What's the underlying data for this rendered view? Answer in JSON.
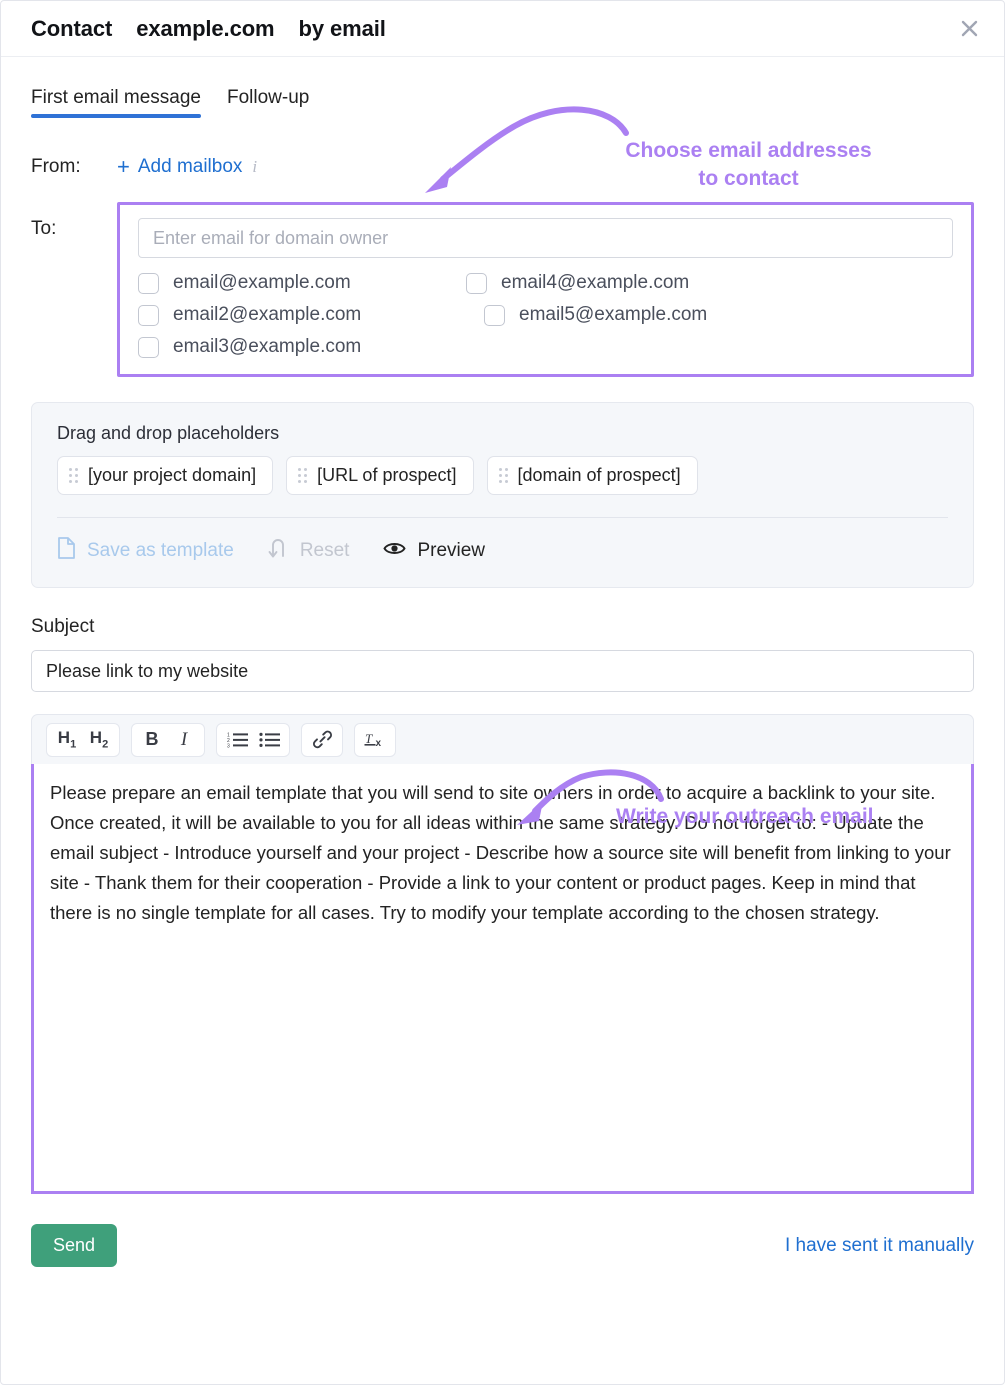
{
  "header": {
    "title_prefix": "Contact",
    "title_domain": "example.com",
    "title_suffix": "by email",
    "close_icon": "close-icon"
  },
  "tabs": [
    {
      "label": "First email message",
      "active": true
    },
    {
      "label": "Follow-up",
      "active": false
    }
  ],
  "from": {
    "label": "From:",
    "add_mailbox_label": "Add mailbox",
    "plus_glyph": "+",
    "info_glyph": "i"
  },
  "to": {
    "label": "To:",
    "input_placeholder": "Enter email for domain owner",
    "input_value": "",
    "emails": [
      {
        "address": "email@example.com",
        "checked": false
      },
      {
        "address": "email4@example.com",
        "checked": false
      },
      {
        "address": "email2@example.com",
        "checked": false
      },
      {
        "address": "email5@example.com",
        "checked": false
      },
      {
        "address": "email3@example.com",
        "checked": false
      }
    ]
  },
  "placeholders": {
    "title": "Drag and drop placeholders",
    "chips": [
      "[your project domain]",
      "[URL of prospect]",
      "[domain of prospect]"
    ],
    "actions": [
      {
        "label": "Save as template",
        "icon": "document-icon",
        "state": "muted-blue"
      },
      {
        "label": "Reset",
        "icon": "undo-arrow-icon",
        "state": "muted-grey"
      },
      {
        "label": "Preview",
        "icon": "eye-icon",
        "state": "active"
      }
    ]
  },
  "subject": {
    "label": "Subject",
    "value": "Please link to my website"
  },
  "editor": {
    "toolbar": [
      {
        "name": "heading-1-button",
        "label": "H",
        "sub": "1"
      },
      {
        "name": "heading-2-button",
        "label": "H",
        "sub": "2"
      },
      {
        "name": "bold-button",
        "label": "B"
      },
      {
        "name": "italic-button",
        "label": "I"
      },
      {
        "name": "ordered-list-button",
        "label": ""
      },
      {
        "name": "bullet-list-button",
        "label": ""
      },
      {
        "name": "link-button",
        "label": ""
      },
      {
        "name": "clear-formatting-button",
        "label": ""
      }
    ],
    "body": "Please prepare an email template that you will send to site owners in order to acquire a backlink to your site. Once created, it will be available to you for all ideas within the same strategy. Do not forget to: - Update the email subject - Introduce yourself and your project - Describe how a source site will benefit from linking to your site - Thank them for their cooperation - Provide a link to your content or product pages. Keep in mind that there is no single template for all cases. Try to modify your template according to the chosen strategy."
  },
  "footer": {
    "send_label": "Send",
    "manual_label": "I have sent it manually"
  },
  "annotations": {
    "choose_emails": "Choose email addresses\nto contact",
    "write_email": "Write your outreach email"
  },
  "colors": {
    "annotation_purple": "#ab80f2",
    "tab_underline_blue": "#2f72d6",
    "link_blue": "#1f6fd0",
    "send_green": "#3fa07b",
    "panel_grey": "#f5f7fa"
  }
}
